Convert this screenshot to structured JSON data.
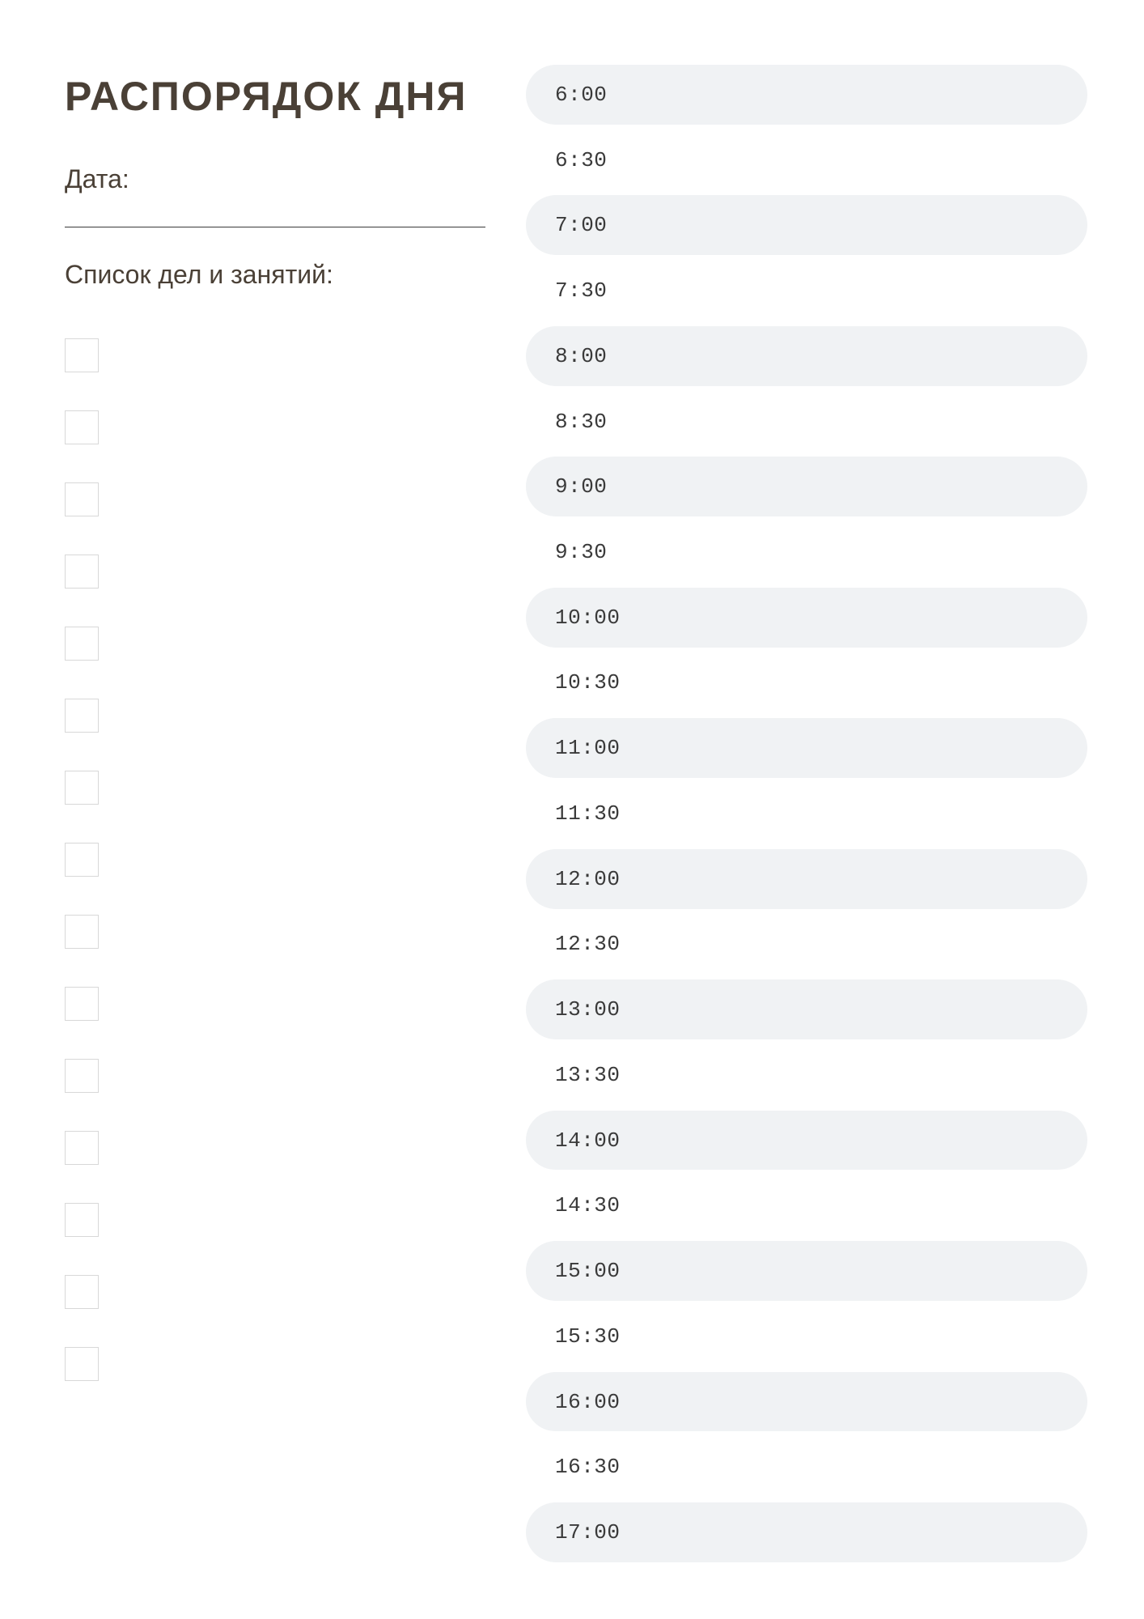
{
  "title": "РАСПОРЯДОК ДНЯ",
  "date_label": "Дата:",
  "tasks_label": "Список дел и занятий:",
  "checkbox_count": 15,
  "time_slots": [
    "6:00",
    "6:30",
    "7:00",
    "7:30",
    "8:00",
    "8:30",
    "9:00",
    "9:30",
    "10:00",
    "10:30",
    "11:00",
    "11:30",
    "12:00",
    "12:30",
    "13:00",
    "13:30",
    "14:00",
    "14:30",
    "15:00",
    "15:30",
    "16:00",
    "16:30",
    "17:00"
  ]
}
